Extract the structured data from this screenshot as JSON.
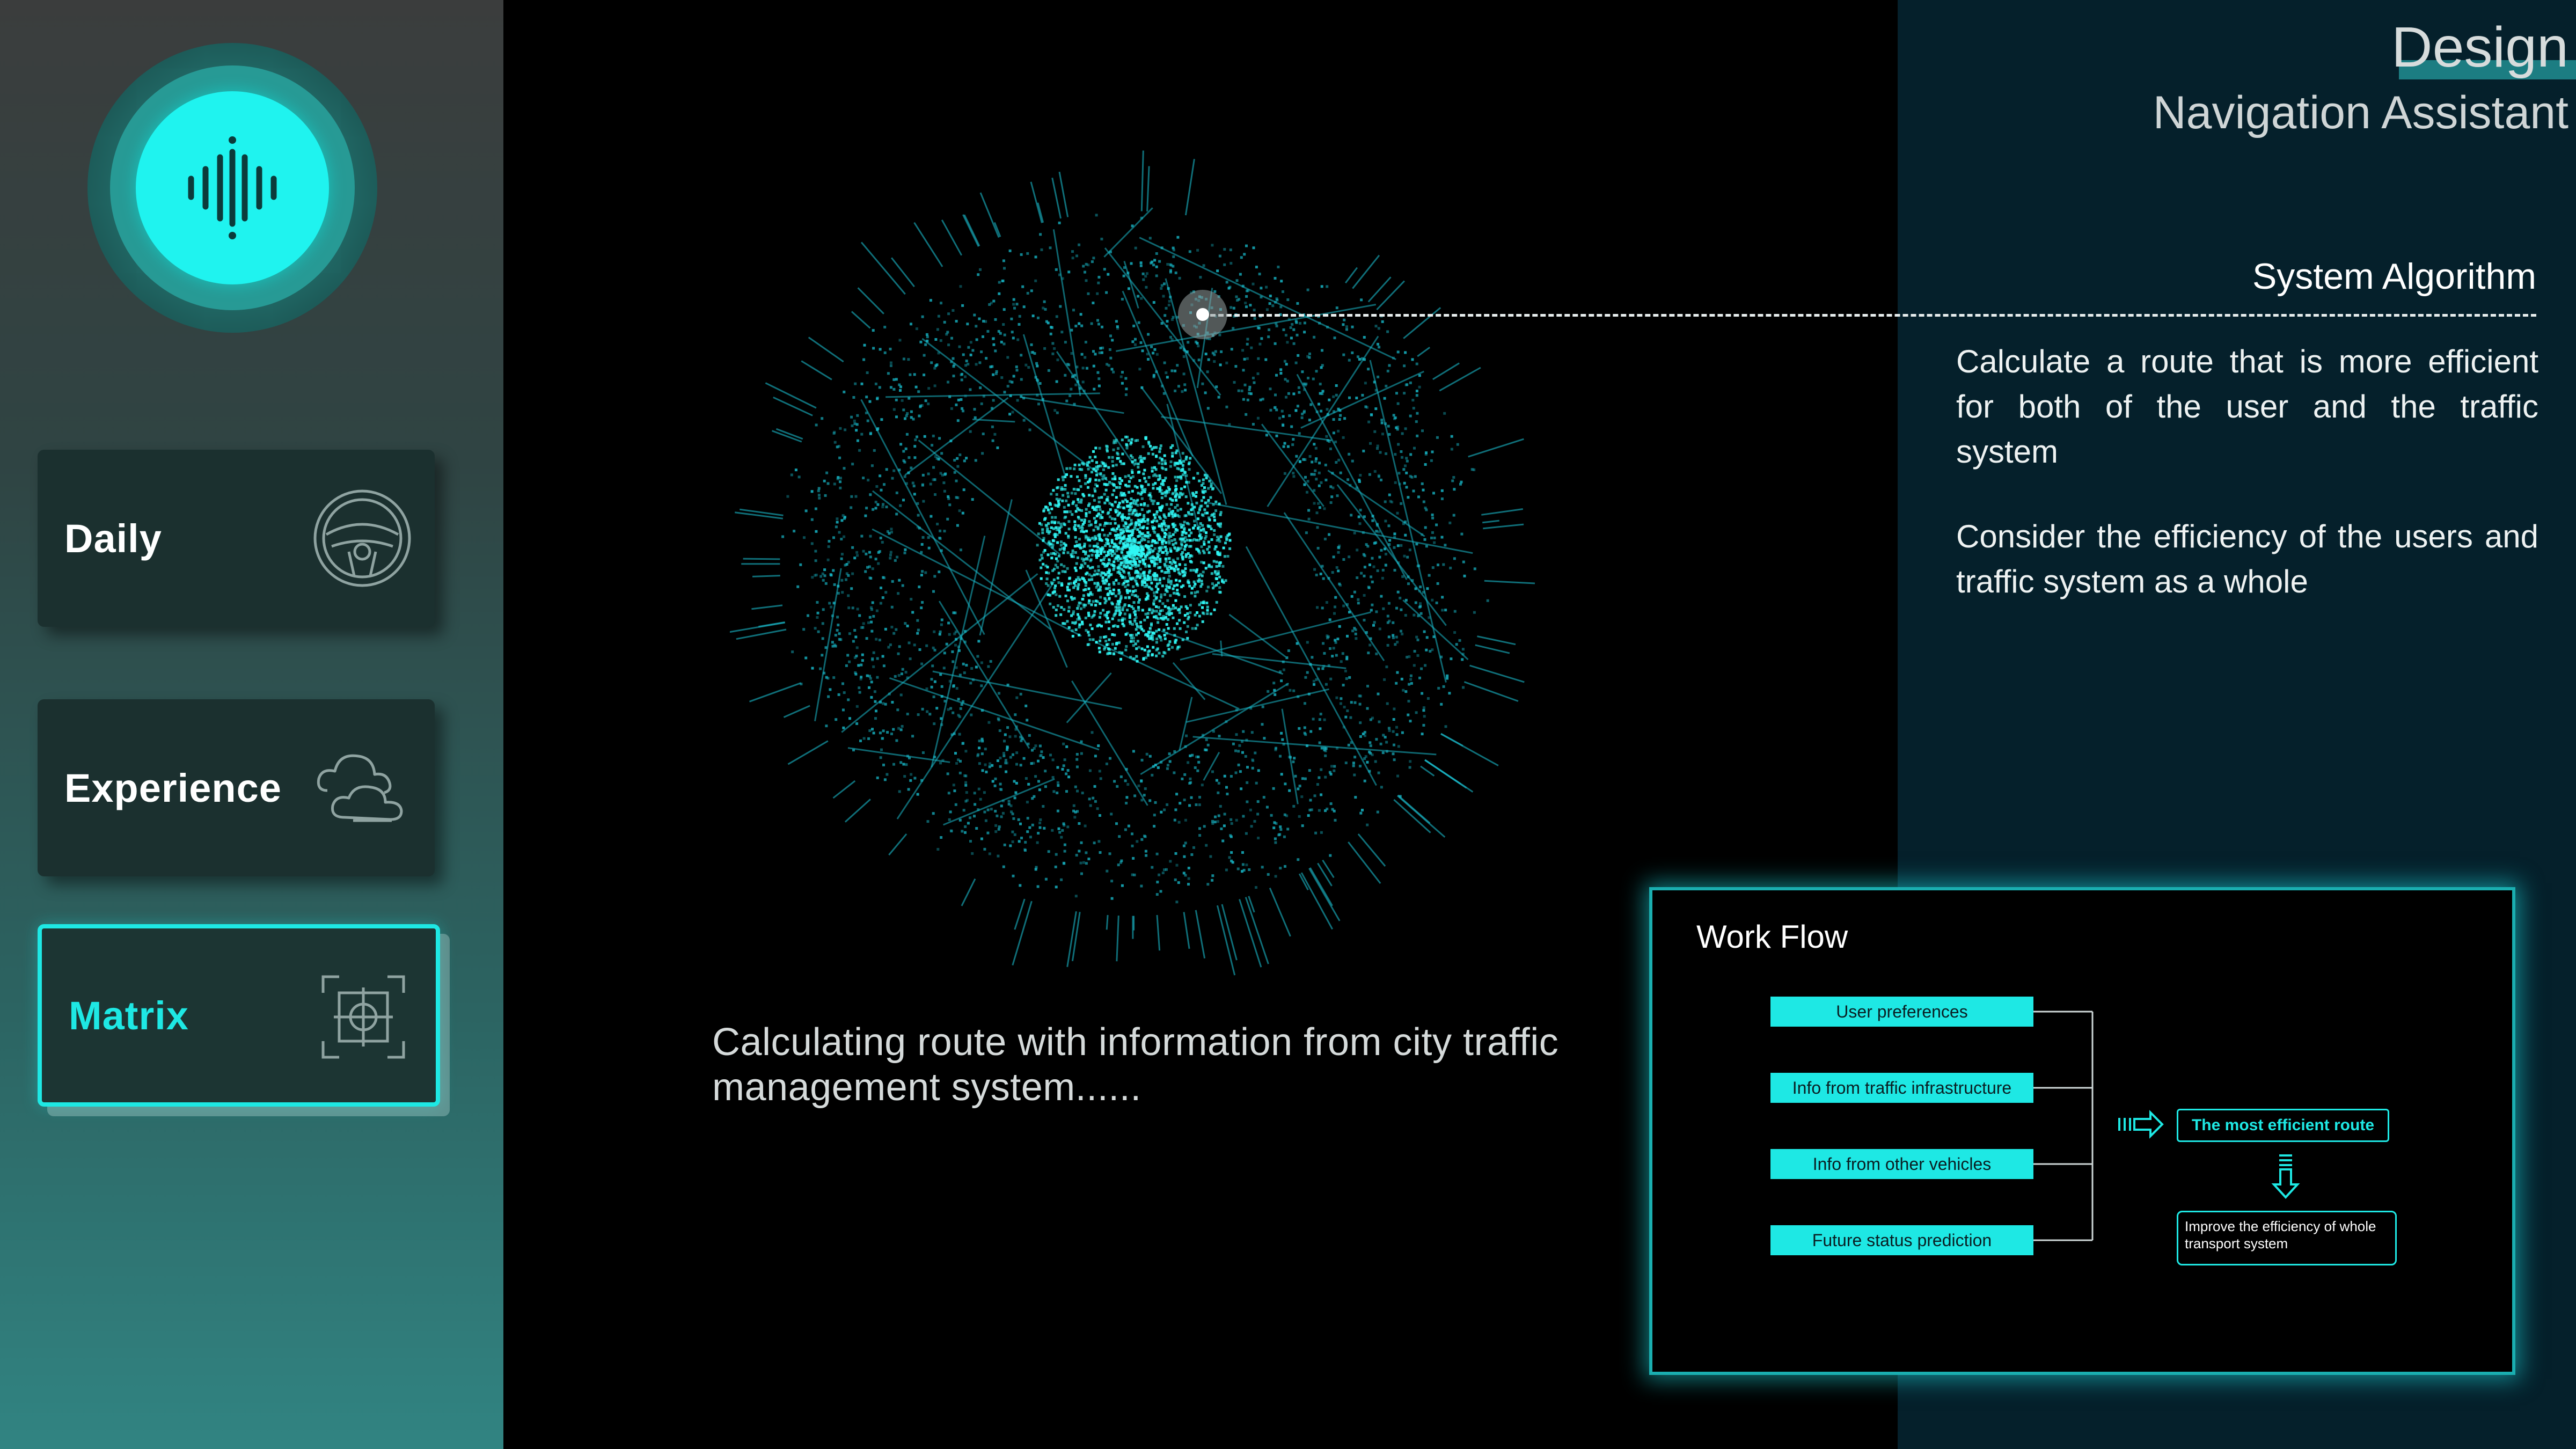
{
  "colors": {
    "accent": "#1ee8e4",
    "panel_dark": "#05202b",
    "sidebar_card": "#1b302f"
  },
  "sidebar": {
    "voice_button_icon": "voice-waveform-icon",
    "items": [
      {
        "label": "Daily",
        "icon": "steering-wheel-icon",
        "active": false
      },
      {
        "label": "Experience",
        "icon": "cloud-icon",
        "active": false
      },
      {
        "label": "Matrix",
        "icon": "target-crosshair-icon",
        "active": true
      }
    ]
  },
  "header": {
    "title": "Design",
    "subtitle": "Navigation Assistant"
  },
  "algorithm": {
    "title": "System Algorithm",
    "paragraphs": [
      "Calculate a route that is more efficient for both of the user and the traffic system",
      "Consider the efficiency of the users and traffic system as a whole"
    ]
  },
  "status_message": "Calculating route with information from city traffic management system......",
  "workflow": {
    "title": "Work Flow",
    "inputs": [
      "User preferences",
      "Info from traffic infrastructure",
      "Info from other vehicles",
      "Future status prediction"
    ],
    "result": "The most efficient route",
    "outcome": "Improve the efficiency of whole transport system"
  }
}
